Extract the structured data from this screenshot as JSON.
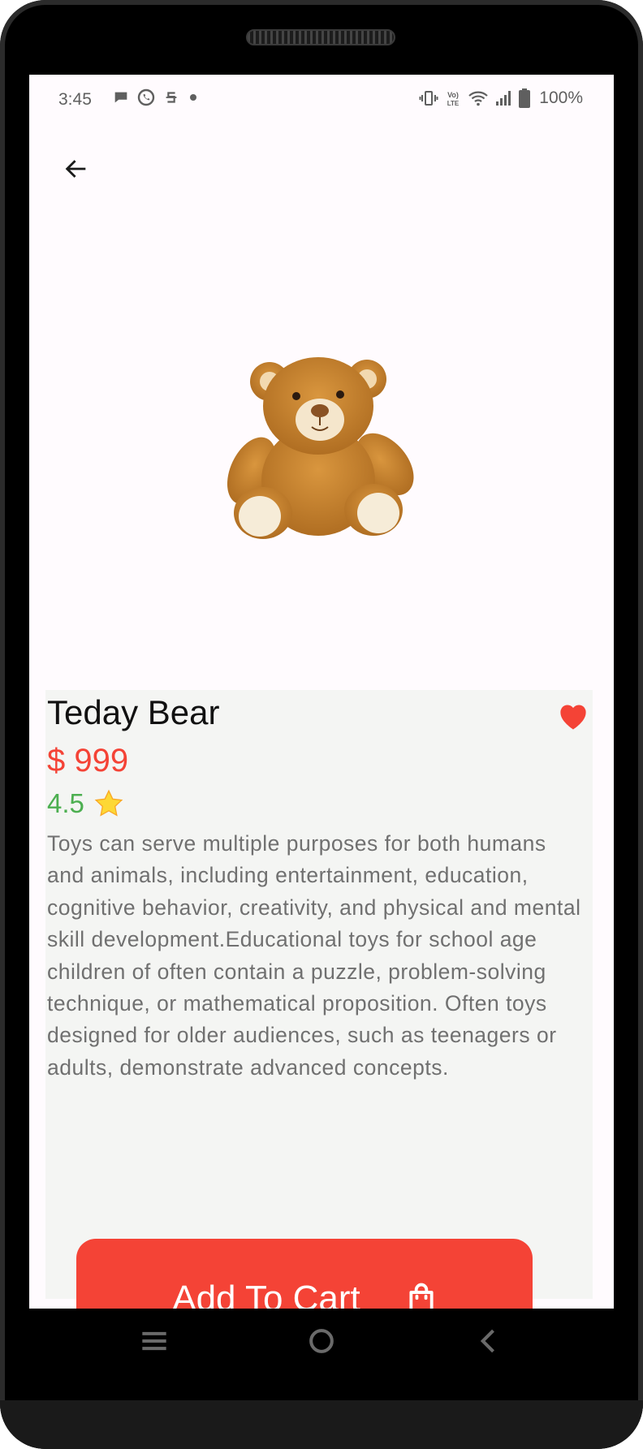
{
  "status_bar": {
    "time": "3:45",
    "battery": "100%",
    "left_icons": [
      "chat-bubble-icon",
      "whatsapp-icon",
      "app-s-icon",
      "dot-icon"
    ],
    "right_icons": [
      "vibrate-icon",
      "volte-icon",
      "wifi-icon",
      "signal-icon",
      "battery-icon"
    ]
  },
  "header": {
    "back_icon": "arrow-left-icon"
  },
  "product": {
    "image_icon": "teddy-bear-image",
    "title": "Teday Bear",
    "price": "$ 999",
    "rating": "4.5",
    "rating_icon": "star-icon",
    "favorite_icon": "heart-icon",
    "description": "Toys can serve multiple purposes for both humans and animals, including entertainment, education, cognitive behavior, creativity, and physical and mental skill development.Educational toys for school age children of often contain a puzzle, problem-solving technique, or mathematical proposition. Often toys designed for older audiences, such as teenagers or adults, demonstrate advanced concepts."
  },
  "actions": {
    "add_to_cart_label": "Add To Cart",
    "cart_icon": "shopping-bag-icon"
  },
  "nav_bar": {
    "items": [
      "menu-icon",
      "home-icon",
      "back-icon"
    ]
  },
  "colors": {
    "accent": "#f44336",
    "rating": "#4caf50",
    "background": "#fffbfe",
    "panel": "#f4f5f3"
  }
}
